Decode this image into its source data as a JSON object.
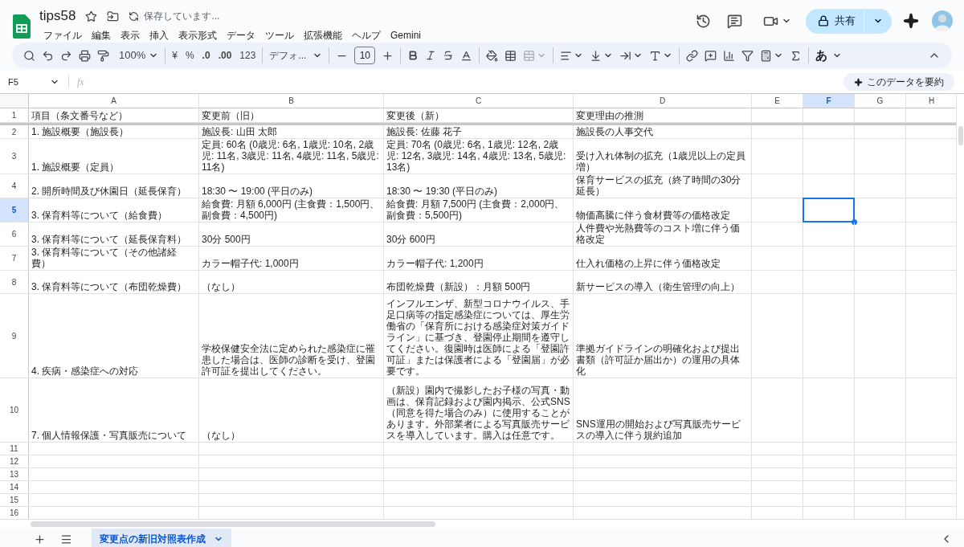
{
  "document": {
    "title": "tips58",
    "save_status": "保存しています..."
  },
  "menu": [
    "ファイル",
    "編集",
    "表示",
    "挿入",
    "表示形式",
    "データ",
    "ツール",
    "拡張機能",
    "ヘルプ",
    "Gemini"
  ],
  "share_button": {
    "label": "共有"
  },
  "toolbar": {
    "zoom": "100%",
    "currency": "¥",
    "percent": "%",
    "decrease_decimal": ".0",
    "increase_decimal": ".00",
    "number_format": "123",
    "font": "デフォ...",
    "font_size": "10",
    "input_tool": "あ"
  },
  "formula_bar": {
    "name_box": "F5",
    "function_label": "fx",
    "summarize_button": "このデータを要約"
  },
  "columns": [
    {
      "label": "A",
      "selected": false
    },
    {
      "label": "B",
      "selected": false
    },
    {
      "label": "C",
      "selected": false
    },
    {
      "label": "D",
      "selected": false
    },
    {
      "label": "E",
      "selected": false
    },
    {
      "label": "F",
      "selected": true
    },
    {
      "label": "G",
      "selected": false
    },
    {
      "label": "H",
      "selected": false
    }
  ],
  "rows": [
    {
      "number": "1",
      "selected": false,
      "cells": [
        "項目（条文番号など）",
        "変更前（旧）",
        "変更後（新）",
        "変更理由の推測"
      ]
    },
    {
      "number": "2",
      "selected": false,
      "cells": [
        "1. 施設概要（施設長）",
        "施設長: 山田 太郎",
        "施設長: 佐藤 花子",
        "施設長の人事交代"
      ]
    },
    {
      "number": "3",
      "selected": false,
      "cells": [
        "1. 施設概要（定員）",
        "定員: 60名 (0歳児: 6名, 1歳児: 10名, 2歳児: 11名, 3歳児: 11名, 4歳児: 11名, 5歳児: 11名)",
        "定員: 70名 (0歳児: 6名, 1歳児: 12名, 2歳児: 12名, 3歳児: 14名, 4歳児: 13名, 5歳児: 13名)",
        "受け入れ体制の拡充（1歳児以上の定員増）"
      ]
    },
    {
      "number": "4",
      "selected": false,
      "cells": [
        "2. 開所時間及び休園日（延長保育）",
        "18:30 〜 19:00 (平日のみ)",
        "18:30 〜 19:30 (平日のみ)",
        "保育サービスの拡充（終了時間の30分延長）"
      ]
    },
    {
      "number": "5",
      "selected": true,
      "cells": [
        "3. 保育料等について（給食費）",
        "給食費: 月額 6,000円 (主食費：1,500円、副食費：4,500円)",
        "給食費: 月額 7,500円 (主食費：2,000円、副食費：5,500円)",
        "物価高騰に伴う食材費等の価格改定"
      ]
    },
    {
      "number": "6",
      "selected": false,
      "cells": [
        "3. 保育料等について（延長保育料）",
        "30分 500円",
        "30分 600円",
        "人件費や光熱費等のコスト増に伴う価格改定"
      ]
    },
    {
      "number": "7",
      "selected": false,
      "cells": [
        "3. 保育料等について（その他諸経費）",
        "カラー帽子代: 1,000円",
        "カラー帽子代: 1,200円",
        "仕入れ価格の上昇に伴う価格改定"
      ]
    },
    {
      "number": "8",
      "selected": false,
      "cells": [
        "3. 保育料等について（布団乾燥費）",
        "（なし）",
        "布団乾燥費（新設）：月額 500円",
        "新サービスの導入（衛生管理の向上）"
      ]
    },
    {
      "number": "9",
      "selected": false,
      "cells": [
        "4. 疾病・感染症への対応",
        "学校保健安全法に定められた感染症に罹患した場合は、医師の診断を受け、登園許可証を提出してください。",
        "インフルエンザ、新型コロナウイルス、手足口病等の指定感染症については、厚生労働省の「保育所における感染症対策ガイドライン」に基づき、登園停止期間を遵守してください。復園時は医師による「登園許可証」または保護者による「登園届」が必要です。",
        "準拠ガイドラインの明確化および提出書類（許可証か届出か）の運用の具体化"
      ]
    },
    {
      "number": "10",
      "selected": false,
      "cells": [
        "7. 個人情報保護・写真販売について",
        "（なし）",
        "（新設）園内で撮影したお子様の写真・動画は、保育記録および園内掲示、公式SNS（同意を得た場合のみ）に使用することがあります。外部業者による写真販売サービスを導入しています。購入は任意です。",
        "SNS運用の開始および写真販売サービスの導入に伴う規約追加"
      ]
    },
    {
      "number": "11",
      "selected": false
    },
    {
      "number": "12",
      "selected": false
    },
    {
      "number": "13",
      "selected": false
    },
    {
      "number": "14",
      "selected": false
    },
    {
      "number": "15",
      "selected": false
    },
    {
      "number": "16",
      "selected": false
    }
  ],
  "sheet_tabs": [
    {
      "label": "変更点の新旧対照表作成",
      "selected": true
    }
  ]
}
